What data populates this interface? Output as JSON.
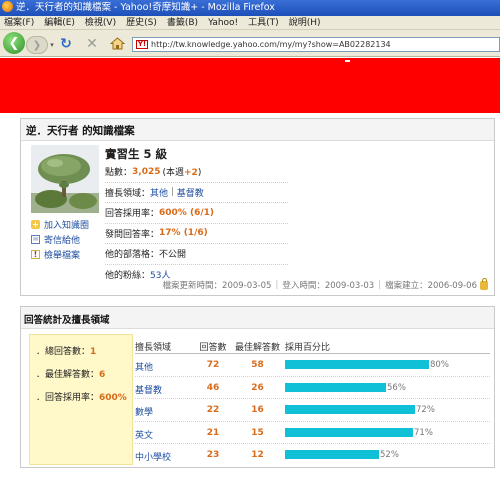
{
  "window": {
    "title": "逆．天行者的知識檔案 - Yahoo!奇摩知識+ - Mozilla Firefox"
  },
  "menu": [
    "檔案(F)",
    "編輯(E)",
    "檢視(V)",
    "歷史(S)",
    "書籤(B)",
    "Yahoo!",
    "工具(T)",
    "說明(H)"
  ],
  "nav": {
    "url": "http://tw.knowledge.yahoo.com/my/my?show=AB02282134",
    "yahoo_badge": "Y!"
  },
  "colors": {
    "ad_band": "#ff0000",
    "accent": "#d86b1a",
    "link": "#1f4fa0",
    "bar": "#10c0d6",
    "summary_bg": "#fff8c8"
  },
  "profile": {
    "title": "逆．天行者 的知識檔案",
    "rank": "實習生 5 級",
    "links": [
      "加入知識圈",
      "寄信給他",
      "檢舉檔案"
    ],
    "points_label": "點數：",
    "points_value": "3,025",
    "points_week": "(本週+2)",
    "expertise_label": "擅長領域：",
    "expertise_1": "其他",
    "expertise_sep": " | ",
    "expertise_2": "基督教",
    "answer_rate_label": "回答採用率：",
    "answer_rate_value": "600% (6/1)",
    "question_rate_label": "發問回答率：",
    "question_rate_value": "17% (1/6)",
    "blog_label": "他的部落格：",
    "blog_value": "不公開",
    "fans_label": "他的粉絲：",
    "fans_value": "53人",
    "updated": "檔案更新時間：2009-03-05",
    "login": "登入時間：2009-03-03",
    "created": "檔案建立：2006-09-06"
  },
  "answer_stats": {
    "title": "回答統計及擅長領域",
    "total_label": "．總回答數：",
    "total_value": "1",
    "best_label": "．最佳解答數：",
    "best_value": "6",
    "rate_label": "．回答採用率：",
    "rate_value": "600%",
    "headers": {
      "field": "擅長領域",
      "answers": "回答數",
      "best": "最佳解答數",
      "rate": "採用百分比"
    },
    "rows": [
      {
        "field": "其他",
        "answers": "72",
        "best": "58",
        "percent": 80,
        "percent_label": "80%"
      },
      {
        "field": "基督教",
        "answers": "46",
        "best": "26",
        "percent": 56,
        "percent_label": "56%"
      },
      {
        "field": "數學",
        "answers": "22",
        "best": "16",
        "percent": 72,
        "percent_label": "72%"
      },
      {
        "field": "英文",
        "answers": "21",
        "best": "15",
        "percent": 71,
        "percent_label": "71%"
      },
      {
        "field": "中小學校",
        "answers": "23",
        "best": "12",
        "percent": 52,
        "percent_label": "52%"
      }
    ]
  }
}
